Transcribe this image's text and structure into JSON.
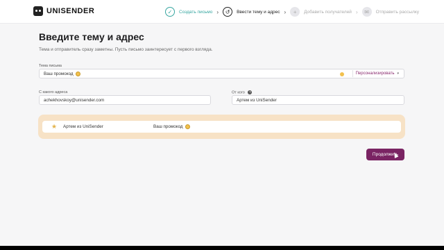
{
  "brand": {
    "name": "UNISENDER"
  },
  "steps": [
    {
      "label": "Создать письмо",
      "icon": "check-icon",
      "state": "done"
    },
    {
      "label": "Ввести тему и адрес",
      "icon": "history-icon",
      "state": "active"
    },
    {
      "label": "Добавить получателей",
      "icon": "add-user-icon",
      "state": "pending"
    },
    {
      "label": "Отправить рассылку",
      "icon": "mail-icon",
      "state": "pending"
    }
  ],
  "page": {
    "title": "Введите тему и адрес",
    "subtitle": "Тема и отправитель сразу заметны. Пусть письмо заинтересует с первого взгляда."
  },
  "form": {
    "subject_label": "Тема письма",
    "subject_value": "Ваш промокод",
    "personalize_label": "Персонализировать",
    "from_email_label": "С какого адреса",
    "from_email_value": "achekhovskoy@unisender.com",
    "from_name_label": "От кого",
    "from_name_value": "Артем из UniSender"
  },
  "preview": {
    "from": "Артем из UniSender",
    "subject": "Ваш промокод"
  },
  "actions": {
    "continue_label": "Продолжить"
  },
  "colors": {
    "accent": "#7a2463",
    "done": "#36a6a0",
    "preview_bg": "#f7e2c6"
  }
}
